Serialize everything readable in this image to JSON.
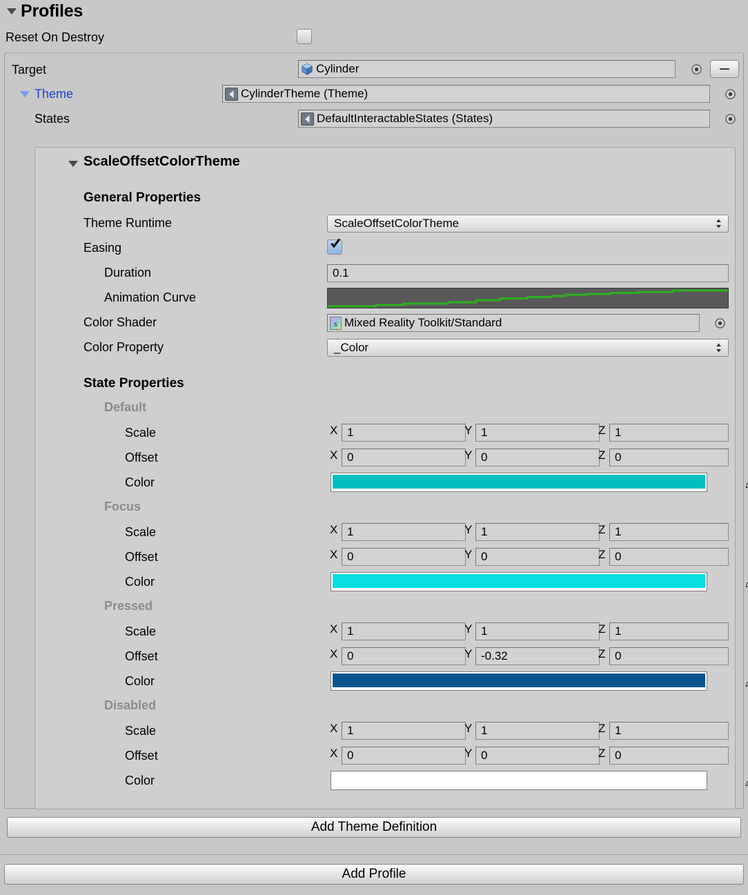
{
  "header": {
    "title": "Profiles",
    "reset_label": "Reset On Destroy",
    "reset_checked": false
  },
  "profile": {
    "target_label": "Target",
    "target_value": "Cylinder",
    "target_icon": "cube-icon",
    "theme_label": "Theme",
    "theme_value": "CylinderTheme (Theme)",
    "theme_icon": "scriptable-object-icon",
    "states_label": "States",
    "states_value": "DefaultInteractableStates (States)",
    "states_icon": "scriptable-object-icon",
    "remove_button_label": "–"
  },
  "theme": {
    "title": "ScaleOffsetColorTheme",
    "general_header": "General Properties",
    "theme_runtime_label": "Theme Runtime",
    "theme_runtime_value": "ScaleOffsetColorTheme",
    "easing_label": "Easing",
    "easing_checked": true,
    "duration_label": "Duration",
    "duration_value": "0.1",
    "animation_curve_label": "Animation Curve",
    "animation_curve_color": "#2bb01e",
    "color_shader_label": "Color Shader",
    "color_shader_value": "Mixed Reality Toolkit/Standard",
    "color_shader_icon": "shader-icon",
    "color_property_label": "Color Property",
    "color_property_value": "_Color",
    "state_header": "State Properties"
  },
  "states": [
    {
      "name": "Default",
      "scale_label": "Scale",
      "scale": {
        "x": "1",
        "y": "1",
        "z": "1"
      },
      "offset_label": "Offset",
      "offset": {
        "x": "0",
        "y": "0",
        "z": "0"
      },
      "color_label": "Color",
      "color": "#02bfbf"
    },
    {
      "name": "Focus",
      "scale_label": "Scale",
      "scale": {
        "x": "1",
        "y": "1",
        "z": "1"
      },
      "offset_label": "Offset",
      "offset": {
        "x": "0",
        "y": "0",
        "z": "0"
      },
      "color_label": "Color",
      "color": "#07dede"
    },
    {
      "name": "Pressed",
      "scale_label": "Scale",
      "scale": {
        "x": "1",
        "y": "1",
        "z": "1"
      },
      "offset_label": "Offset",
      "offset": {
        "x": "0",
        "y": "-0.32",
        "z": "0"
      },
      "color_label": "Color",
      "color": "#0b558e"
    },
    {
      "name": "Disabled",
      "scale_label": "Scale",
      "scale": {
        "x": "1",
        "y": "1",
        "z": "1"
      },
      "offset_label": "Offset",
      "offset": {
        "x": "0",
        "y": "0",
        "z": "0"
      },
      "color_label": "Color",
      "color": "#ffffff"
    }
  ],
  "axis": {
    "x": "X",
    "y": "Y",
    "z": "Z"
  },
  "buttons": {
    "add_theme_definition": "Add Theme Definition",
    "add_profile": "Add Profile"
  }
}
